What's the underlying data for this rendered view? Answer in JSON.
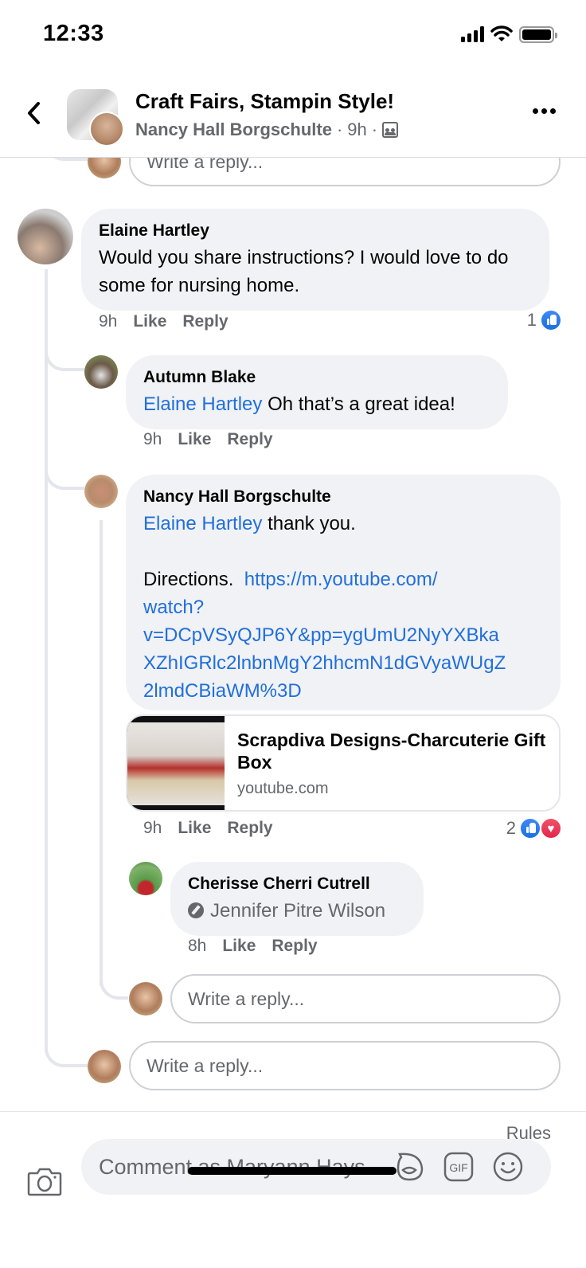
{
  "status_bar": {
    "time": "12:33"
  },
  "header": {
    "group_name": "Craft Fairs, Stampin Style!",
    "poster": "Nancy Hall Borgschulte",
    "separator": "·",
    "time": "9h",
    "privacy_icon": "members-group-icon",
    "back_icon": "chevron-left-icon",
    "more_icon": "more-horizontal-icon"
  },
  "reply_placeholder": "Write a reply...",
  "comments": [
    {
      "author": "Elaine Hartley",
      "text": "Would you share instructions?  I would love to do some for nursing home.",
      "time": "9h",
      "like_label": "Like",
      "reply_label": "Reply",
      "reaction_count": "1",
      "reactions": [
        "like"
      ],
      "replies": [
        {
          "author": "Autumn Blake",
          "mention": "Elaine Hartley",
          "text": " Oh that’s a great idea!",
          "time": "9h",
          "like_label": "Like",
          "reply_label": "Reply"
        },
        {
          "author": "Nancy Hall Borgschulte",
          "mention": "Elaine Hartley",
          "text": " thank you.",
          "directions_label": "Directions.  ",
          "link_text_1": "https://m.youtube.com/",
          "link_text_2": "watch?",
          "link_text_3": "v=DCpVSyQJP6Y&pp=ygUmU2NyYXBka",
          "link_text_4": "XZhIGRlc2lnbnMgY2hhcmN1dGVyaWUgZ",
          "link_text_5": "2lmdCBiaWM%3D",
          "link_card": {
            "title": "Scrapdiva Designs-Charcuterie Gift Box",
            "domain": "youtube.com"
          },
          "time": "9h",
          "like_label": "Like",
          "reply_label": "Reply",
          "reaction_count": "2",
          "reactions": [
            "like",
            "love"
          ],
          "replies": [
            {
              "author": "Cherisse Cherri Cutrell",
              "tag": "Jennifer Pitre Wilson",
              "time": "8h",
              "like_label": "Like",
              "reply_label": "Reply"
            }
          ]
        }
      ]
    }
  ],
  "composer": {
    "rules_label": "Rules",
    "placeholder": "Comment as Maryann Hays...",
    "icons": [
      "camera-icon",
      "avatar-sticker-icon",
      "gif-icon",
      "emoji-icon"
    ]
  },
  "colors": {
    "link": "#216fdb",
    "bubble": "#f0f2f5",
    "meta": "#65676b",
    "like": "#1b6fe3",
    "love": "#e2264d"
  }
}
